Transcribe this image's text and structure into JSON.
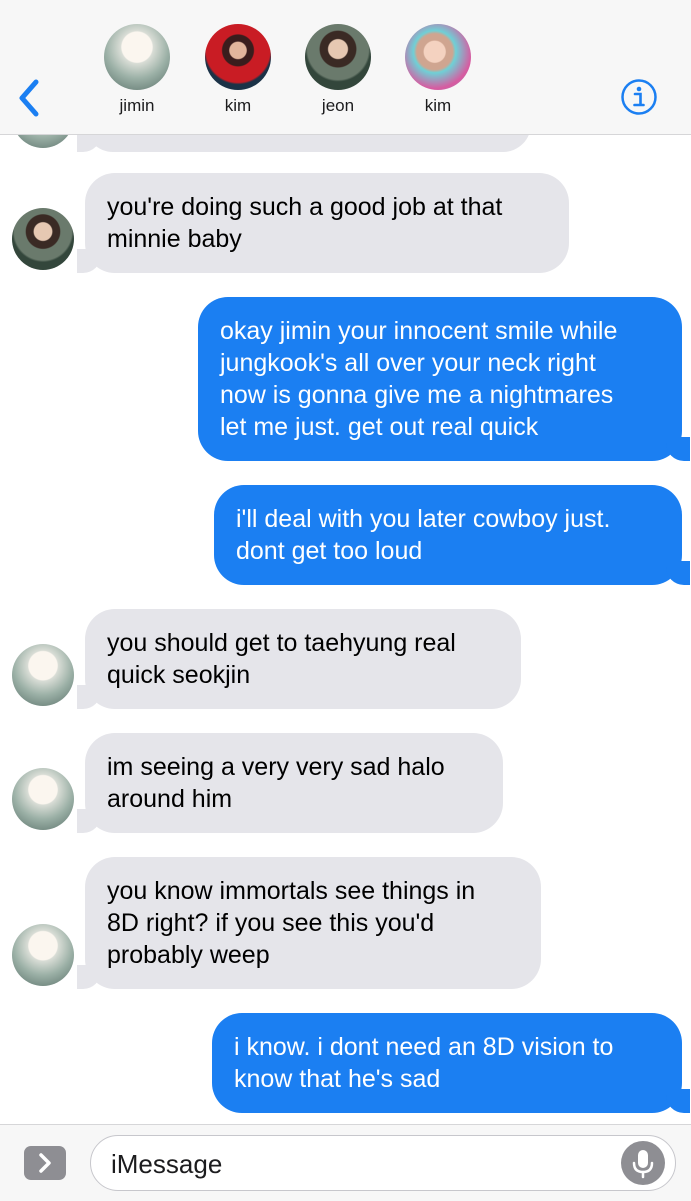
{
  "header": {
    "back_icon": "chevron-left-icon",
    "info_icon": "info-circle-icon",
    "accent_color": "#1b7ff2",
    "participants": [
      {
        "name": "jimin"
      },
      {
        "name": "kim"
      },
      {
        "name": "jeon"
      },
      {
        "name": "kim"
      }
    ]
  },
  "messages": [
    {
      "direction": "received",
      "sender": "jeon",
      "text": "you're doing such a good job at that\nminnie baby"
    },
    {
      "direction": "sent",
      "text": "okay jimin your innocent smile while\njungkook's all over your neck right\nnow is gonna give me a nightmares\nlet me just. get out real quick"
    },
    {
      "direction": "sent",
      "text": "i'll deal with you later cowboy just.\ndont get too loud"
    },
    {
      "direction": "received",
      "sender": "jimin",
      "text": "you should get to taehyung real\nquick seokjin"
    },
    {
      "direction": "received",
      "sender": "jimin",
      "text": "im seeing a very very sad halo\naround him"
    },
    {
      "direction": "received",
      "sender": "jimin",
      "text": "you know immortals see things in\n8D right? if you see this you'd\nprobably weep"
    },
    {
      "direction": "sent",
      "text": "i know. i dont need an 8D vision to\nknow that he's sad"
    }
  ],
  "input": {
    "apps_icon": "chevron-right-icon",
    "placeholder": "iMessage",
    "mic_icon": "microphone-icon"
  },
  "colors": {
    "sent_bubble": "#1b7ff2",
    "received_bubble": "#e5e5ea"
  }
}
